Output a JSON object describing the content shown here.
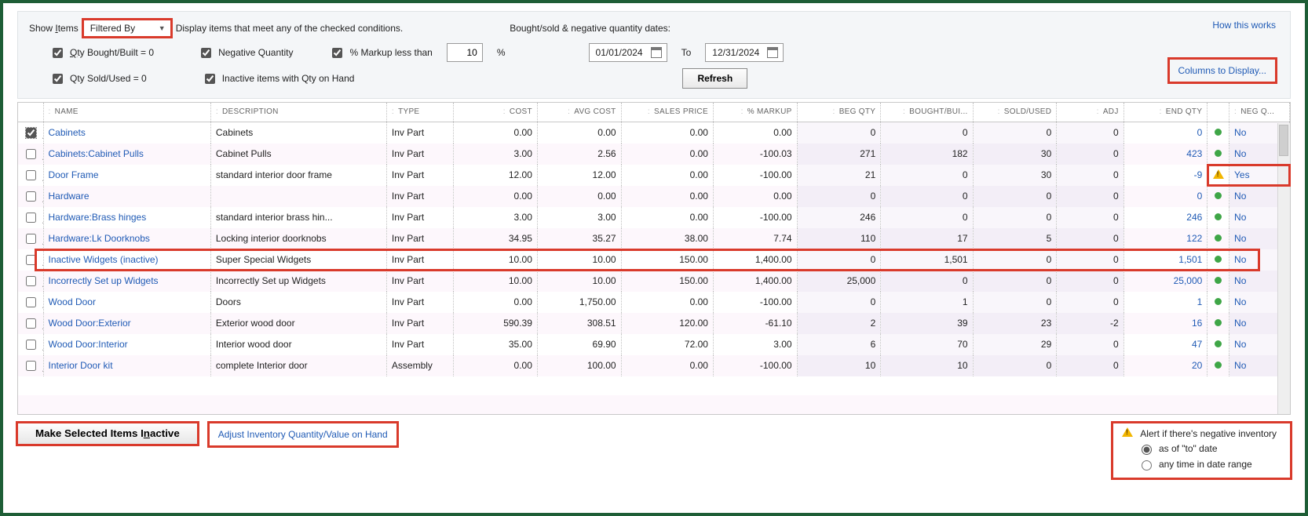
{
  "filter": {
    "show_items_label": "Show Items",
    "dropdown_value": "Filtered By",
    "explain": "Display items that meet any of the checked conditions.",
    "date_header": "Bought/sold & negative quantity dates:",
    "chk_qty_bought": "Qty Bought/Built = 0",
    "chk_qty_sold": "Qty Sold/Used = 0",
    "chk_neg_qty": "Negative Quantity",
    "chk_inactive": "Inactive items with Qty on Hand",
    "chk_markup": "% Markup less than",
    "markup_value": "10",
    "pct": "%",
    "date_from": "01/01/2024",
    "to": "To",
    "date_to": "12/31/2024",
    "refresh": "Refresh",
    "how_link": "How this works",
    "columns_link": "Columns to Display..."
  },
  "columns": {
    "name": "NAME",
    "desc": "DESCRIPTION",
    "type": "TYPE",
    "cost": "COST",
    "avg": "AVG COST",
    "price": "SALES PRICE",
    "markup": "% MARKUP",
    "beg": "BEG QTY",
    "bought": "BOUGHT/BUI...",
    "sold": "SOLD/USED",
    "adj": "ADJ",
    "end": "END QTY",
    "negq": "NEG Q..."
  },
  "rows": [
    {
      "chk": true,
      "name": "Cabinets",
      "desc": "Cabinets",
      "type": "Inv Part",
      "cost": "0.00",
      "avg": "0.00",
      "price": "0.00",
      "markup": "0.00",
      "beg": "0",
      "bought": "0",
      "sold": "0",
      "adj": "0",
      "end": "0",
      "neg": "No",
      "warn": false
    },
    {
      "chk": false,
      "name": "Cabinets:Cabinet Pulls",
      "desc": "Cabinet Pulls",
      "type": "Inv Part",
      "cost": "3.00",
      "avg": "2.56",
      "price": "0.00",
      "markup": "-100.03",
      "beg": "271",
      "bought": "182",
      "sold": "30",
      "adj": "0",
      "end": "423",
      "neg": "No",
      "warn": false
    },
    {
      "chk": false,
      "name": "Door Frame",
      "desc": "standard interior door frame",
      "type": "Inv Part",
      "cost": "12.00",
      "avg": "12.00",
      "price": "0.00",
      "markup": "-100.00",
      "beg": "21",
      "bought": "0",
      "sold": "30",
      "adj": "0",
      "end": "-9",
      "neg": "Yes",
      "warn": true
    },
    {
      "chk": false,
      "name": "Hardware",
      "desc": "",
      "type": "Inv Part",
      "cost": "0.00",
      "avg": "0.00",
      "price": "0.00",
      "markup": "0.00",
      "beg": "0",
      "bought": "0",
      "sold": "0",
      "adj": "0",
      "end": "0",
      "neg": "No",
      "warn": false
    },
    {
      "chk": false,
      "name": "Hardware:Brass hinges",
      "desc": "standard interior brass hin...",
      "type": "Inv Part",
      "cost": "3.00",
      "avg": "3.00",
      "price": "0.00",
      "markup": "-100.00",
      "beg": "246",
      "bought": "0",
      "sold": "0",
      "adj": "0",
      "end": "246",
      "neg": "No",
      "warn": false
    },
    {
      "chk": false,
      "name": "Hardware:Lk Doorknobs",
      "desc": "Locking interior doorknobs",
      "type": "Inv Part",
      "cost": "34.95",
      "avg": "35.27",
      "price": "38.00",
      "markup": "7.74",
      "beg": "110",
      "bought": "17",
      "sold": "5",
      "adj": "0",
      "end": "122",
      "neg": "No",
      "warn": false
    },
    {
      "chk": false,
      "name": "Inactive Widgets (inactive)",
      "desc": "Super Special Widgets",
      "type": "Inv Part",
      "cost": "10.00",
      "avg": "10.00",
      "price": "150.00",
      "markup": "1,400.00",
      "beg": "0",
      "bought": "1,501",
      "sold": "0",
      "adj": "0",
      "end": "1,501",
      "neg": "No",
      "warn": false
    },
    {
      "chk": false,
      "name": "Incorrectly Set up Widgets",
      "desc": "Incorrectly Set up Widgets",
      "type": "Inv Part",
      "cost": "10.00",
      "avg": "10.00",
      "price": "150.00",
      "markup": "1,400.00",
      "beg": "25,000",
      "bought": "0",
      "sold": "0",
      "adj": "0",
      "end": "25,000",
      "neg": "No",
      "warn": false
    },
    {
      "chk": false,
      "name": "Wood Door",
      "desc": "Doors",
      "type": "Inv Part",
      "cost": "0.00",
      "avg": "1,750.00",
      "price": "0.00",
      "markup": "-100.00",
      "beg": "0",
      "bought": "1",
      "sold": "0",
      "adj": "0",
      "end": "1",
      "neg": "No",
      "warn": false
    },
    {
      "chk": false,
      "name": "Wood Door:Exterior",
      "desc": "Exterior wood door",
      "type": "Inv Part",
      "cost": "590.39",
      "avg": "308.51",
      "price": "120.00",
      "markup": "-61.10",
      "beg": "2",
      "bought": "39",
      "sold": "23",
      "adj": "-2",
      "end": "16",
      "neg": "No",
      "warn": false
    },
    {
      "chk": false,
      "name": "Wood Door:Interior",
      "desc": "Interior wood door",
      "type": "Inv Part",
      "cost": "35.00",
      "avg": "69.90",
      "price": "72.00",
      "markup": "3.00",
      "beg": "6",
      "bought": "70",
      "sold": "29",
      "adj": "0",
      "end": "47",
      "neg": "No",
      "warn": false
    },
    {
      "chk": false,
      "name": "Interior Door kit",
      "desc": "complete Interior door",
      "type": "Inv Part",
      "cost": "0.00",
      "avg": "100.00",
      "price": "0.00",
      "markup": "-100.00",
      "beg": "10",
      "bought": "10",
      "sold": "0",
      "adj": "0",
      "end": "20",
      "neg": "No",
      "warn": false
    }
  ],
  "rows_type_override": {
    "11": "Assembly"
  },
  "footer": {
    "make_inactive": "Make Selected Items Inactive",
    "adjust_link": "Adjust Inventory Quantity/Value on Hand",
    "alert_label": "Alert if there's negative inventory",
    "opt_as_of": "as of \"to\" date",
    "opt_range": "any time in date range"
  }
}
